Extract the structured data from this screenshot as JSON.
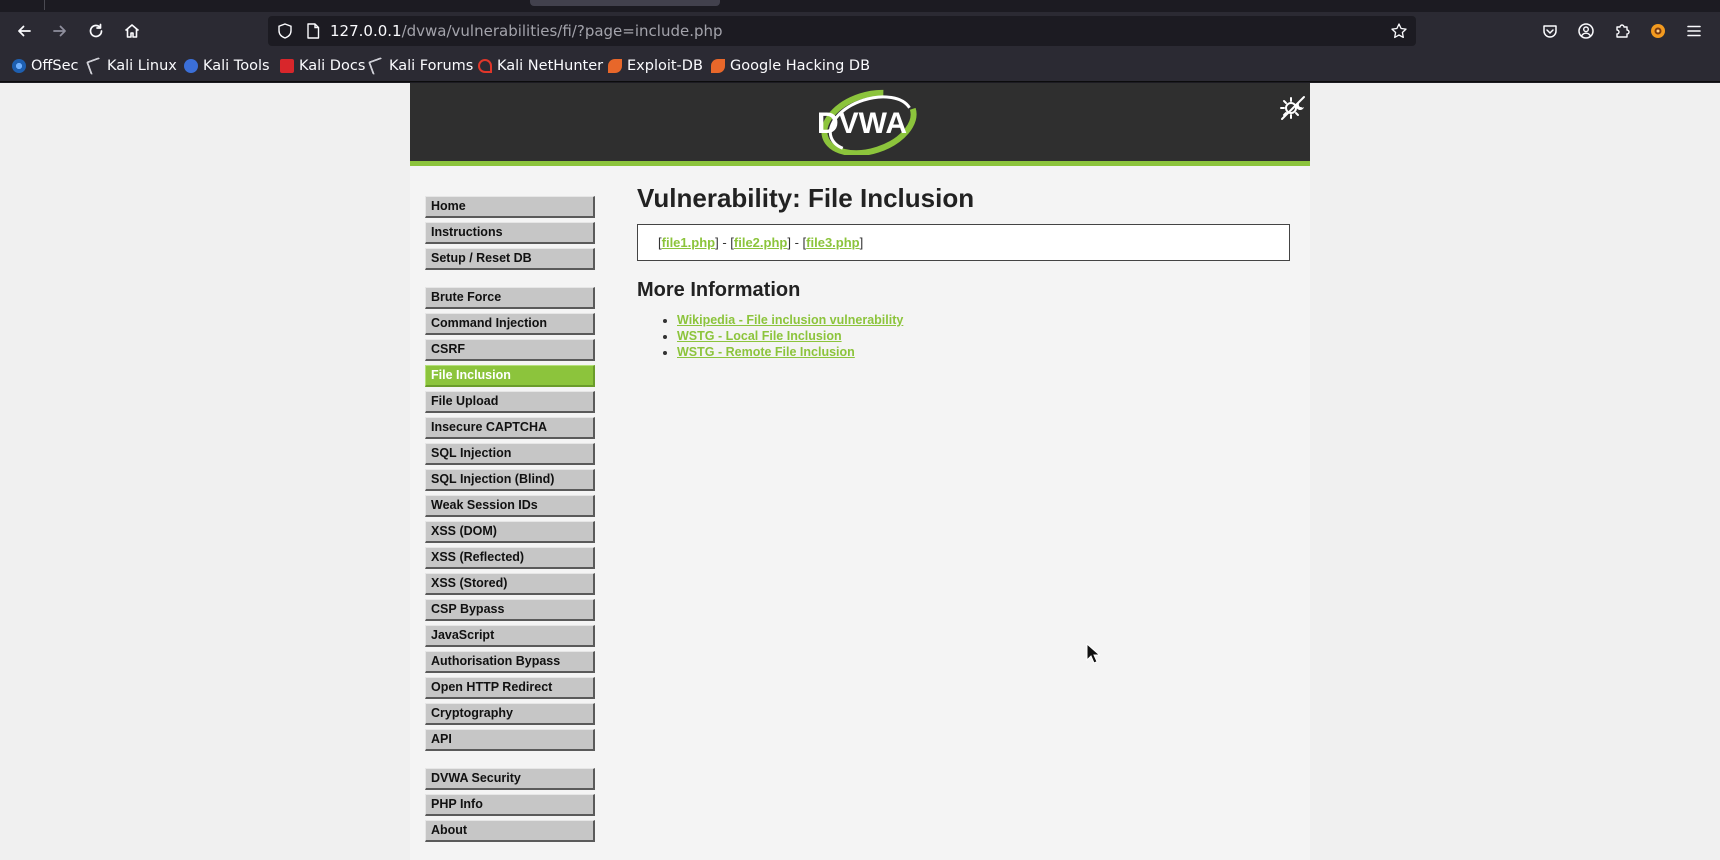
{
  "browser": {
    "url_host": "127.0.0.1",
    "url_path": "/dvwa/vulnerabilities/fi/?page=include.php",
    "bookmarks": [
      {
        "label": "OffSec",
        "icon": "offsec-icon",
        "color": "#3b82c4"
      },
      {
        "label": "Kali Linux",
        "icon": "kali-dragon-icon",
        "color": "#cfcfd6"
      },
      {
        "label": "Kali Tools",
        "icon": "kali-tools-icon",
        "color": "#3b6fd8"
      },
      {
        "label": "Kali Docs",
        "icon": "kali-docs-icon",
        "color": "#d8262b"
      },
      {
        "label": "Kali Forums",
        "icon": "kali-dragon-icon",
        "color": "#cfcfd6"
      },
      {
        "label": "Kali NetHunter",
        "icon": "nethunter-icon",
        "color": "#e0362a"
      },
      {
        "label": "Exploit-DB",
        "icon": "exploit-db-icon",
        "color": "#e8672a"
      },
      {
        "label": "Google Hacking DB",
        "icon": "ghdb-icon",
        "color": "#e8672a"
      }
    ]
  },
  "app": {
    "logo_text": "DVWA",
    "accent_color": "#8cc43c",
    "menu": {
      "group1": [
        {
          "label": "Home"
        },
        {
          "label": "Instructions"
        },
        {
          "label": "Setup / Reset DB"
        }
      ],
      "group2": [
        {
          "label": "Brute Force"
        },
        {
          "label": "Command Injection"
        },
        {
          "label": "CSRF"
        },
        {
          "label": "File Inclusion",
          "selected": true
        },
        {
          "label": "File Upload"
        },
        {
          "label": "Insecure CAPTCHA"
        },
        {
          "label": "SQL Injection"
        },
        {
          "label": "SQL Injection (Blind)"
        },
        {
          "label": "Weak Session IDs"
        },
        {
          "label": "XSS (DOM)"
        },
        {
          "label": "XSS (Reflected)"
        },
        {
          "label": "XSS (Stored)"
        },
        {
          "label": "CSP Bypass"
        },
        {
          "label": "JavaScript"
        },
        {
          "label": "Authorisation Bypass"
        },
        {
          "label": "Open HTTP Redirect"
        },
        {
          "label": "Cryptography"
        },
        {
          "label": "API"
        }
      ],
      "group3": [
        {
          "label": "DVWA Security"
        },
        {
          "label": "PHP Info"
        },
        {
          "label": "About"
        }
      ]
    },
    "page_title": "Vulnerability: File Inclusion",
    "files": [
      "file1.php",
      "file2.php",
      "file3.php"
    ],
    "file_separator": " - ",
    "more_info_title": "More Information",
    "more_info_links": [
      "Wikipedia - File inclusion vulnerability",
      "WSTG - Local File Inclusion",
      "WSTG - Remote File Inclusion"
    ]
  }
}
